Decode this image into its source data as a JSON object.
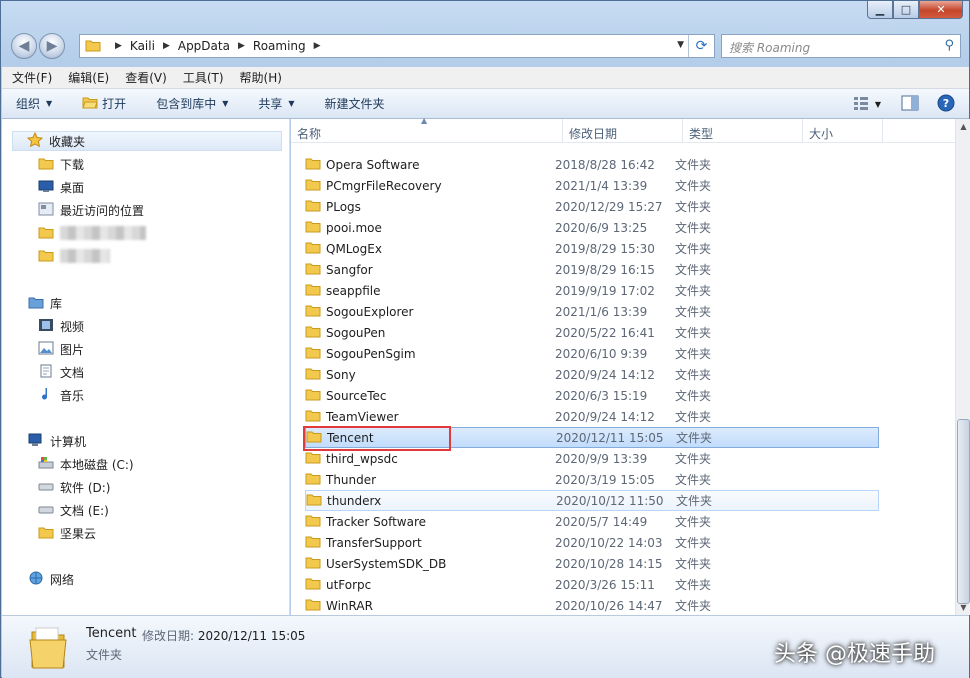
{
  "window": {
    "caption": {
      "minimize": "▁",
      "maximize": "□",
      "close": "✕"
    }
  },
  "address": {
    "crumbs": [
      "Kaili",
      "AppData",
      "Roaming"
    ],
    "separator": "▶",
    "back": "◀",
    "forward": "▶"
  },
  "search": {
    "placeholder": "搜索 Roaming",
    "icon": "magnifier-icon"
  },
  "menu": [
    "文件(F)",
    "编辑(E)",
    "查看(V)",
    "工具(T)",
    "帮助(H)"
  ],
  "toolbar": {
    "organize": "组织",
    "open": "打开",
    "include_in_library": "包含到库中",
    "share": "共享",
    "new_folder": "新建文件夹"
  },
  "nav": {
    "favorites": {
      "label": "收藏夹",
      "items": [
        "下载",
        "桌面",
        "最近访问的位置"
      ]
    },
    "libraries": {
      "label": "库",
      "items": [
        "视频",
        "图片",
        "文档",
        "音乐"
      ]
    },
    "computer": {
      "label": "计算机",
      "items": [
        "本地磁盘 (C:)",
        "软件 (D:)",
        "文档 (E:)",
        "坚果云"
      ]
    },
    "network": {
      "label": "网络"
    }
  },
  "columns": {
    "name": "名称",
    "modified": "修改日期",
    "type": "类型",
    "size": "大小"
  },
  "files": [
    {
      "name": "Opera Software",
      "date": "2018/8/28 16:42",
      "type": "文件夹"
    },
    {
      "name": "PCmgrFileRecovery",
      "date": "2021/1/4 13:39",
      "type": "文件夹"
    },
    {
      "name": "PLogs",
      "date": "2020/12/29 15:27",
      "type": "文件夹"
    },
    {
      "name": "pooi.moe",
      "date": "2020/6/9 13:25",
      "type": "文件夹"
    },
    {
      "name": "QMLogEx",
      "date": "2019/8/29 15:30",
      "type": "文件夹"
    },
    {
      "name": "Sangfor",
      "date": "2019/8/29 16:15",
      "type": "文件夹"
    },
    {
      "name": "seappfile",
      "date": "2019/9/19 17:02",
      "type": "文件夹"
    },
    {
      "name": "SogouExplorer",
      "date": "2021/1/6 13:39",
      "type": "文件夹"
    },
    {
      "name": "SogouPen",
      "date": "2020/5/22 16:41",
      "type": "文件夹"
    },
    {
      "name": "SogouPenSgim",
      "date": "2020/6/10 9:39",
      "type": "文件夹"
    },
    {
      "name": "Sony",
      "date": "2020/9/24 14:12",
      "type": "文件夹"
    },
    {
      "name": "SourceTec",
      "date": "2020/6/3 15:19",
      "type": "文件夹"
    },
    {
      "name": "TeamViewer",
      "date": "2020/9/24 14:12",
      "type": "文件夹"
    },
    {
      "name": "Tencent",
      "date": "2020/12/11 15:05",
      "type": "文件夹"
    },
    {
      "name": "third_wpsdc",
      "date": "2020/9/9 13:39",
      "type": "文件夹"
    },
    {
      "name": "Thunder",
      "date": "2020/3/19 15:05",
      "type": "文件夹"
    },
    {
      "name": "thunderx",
      "date": "2020/10/12 11:50",
      "type": "文件夹"
    },
    {
      "name": "Tracker Software",
      "date": "2020/5/7 14:49",
      "type": "文件夹"
    },
    {
      "name": "TransferSupport",
      "date": "2020/10/22 14:03",
      "type": "文件夹"
    },
    {
      "name": "UserSystemSDK_DB",
      "date": "2020/10/28 14:15",
      "type": "文件夹"
    },
    {
      "name": "utForpc",
      "date": "2020/3/26 15:11",
      "type": "文件夹"
    },
    {
      "name": "WinRAR",
      "date": "2020/10/26 14:47",
      "type": "文件夹"
    }
  ],
  "selected_index": 13,
  "hover_index": 16,
  "details": {
    "name": "Tencent",
    "modified_label": "修改日期:",
    "modified": "2020/12/11 15:05",
    "type": "文件夹"
  },
  "watermark": "头条 @极速手助",
  "colors": {
    "selection": "#c1dcfc",
    "highlight_box": "#e23a3a",
    "folder": "#f2c94c"
  }
}
